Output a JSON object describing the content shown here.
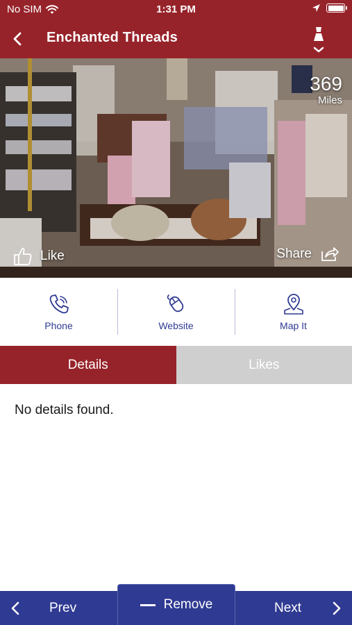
{
  "status_bar": {
    "carrier": "No SIM",
    "time": "1:31 PM"
  },
  "nav": {
    "title": "Enchanted Threads",
    "back_icon": "chevron-left-icon",
    "filter_icon": "dress-filter-icon"
  },
  "hero": {
    "distance_value": "369",
    "distance_unit": "Miles",
    "like_label": "Like",
    "share_label": "Share"
  },
  "actions": [
    {
      "label": "Phone",
      "icon": "phone-icon"
    },
    {
      "label": "Website",
      "icon": "mouse-icon"
    },
    {
      "label": "Map It",
      "icon": "map-pin-icon"
    }
  ],
  "tabs": [
    {
      "label": "Details",
      "active": true
    },
    {
      "label": "Likes",
      "active": false
    }
  ],
  "content": {
    "message": "No details found."
  },
  "bottom_bar": {
    "prev_label": "Prev",
    "remove_label": "Remove",
    "next_label": "Next"
  },
  "colors": {
    "brand_red": "#97232a",
    "brand_blue": "#2f3a92",
    "inactive_tab": "#cfcfcf"
  }
}
